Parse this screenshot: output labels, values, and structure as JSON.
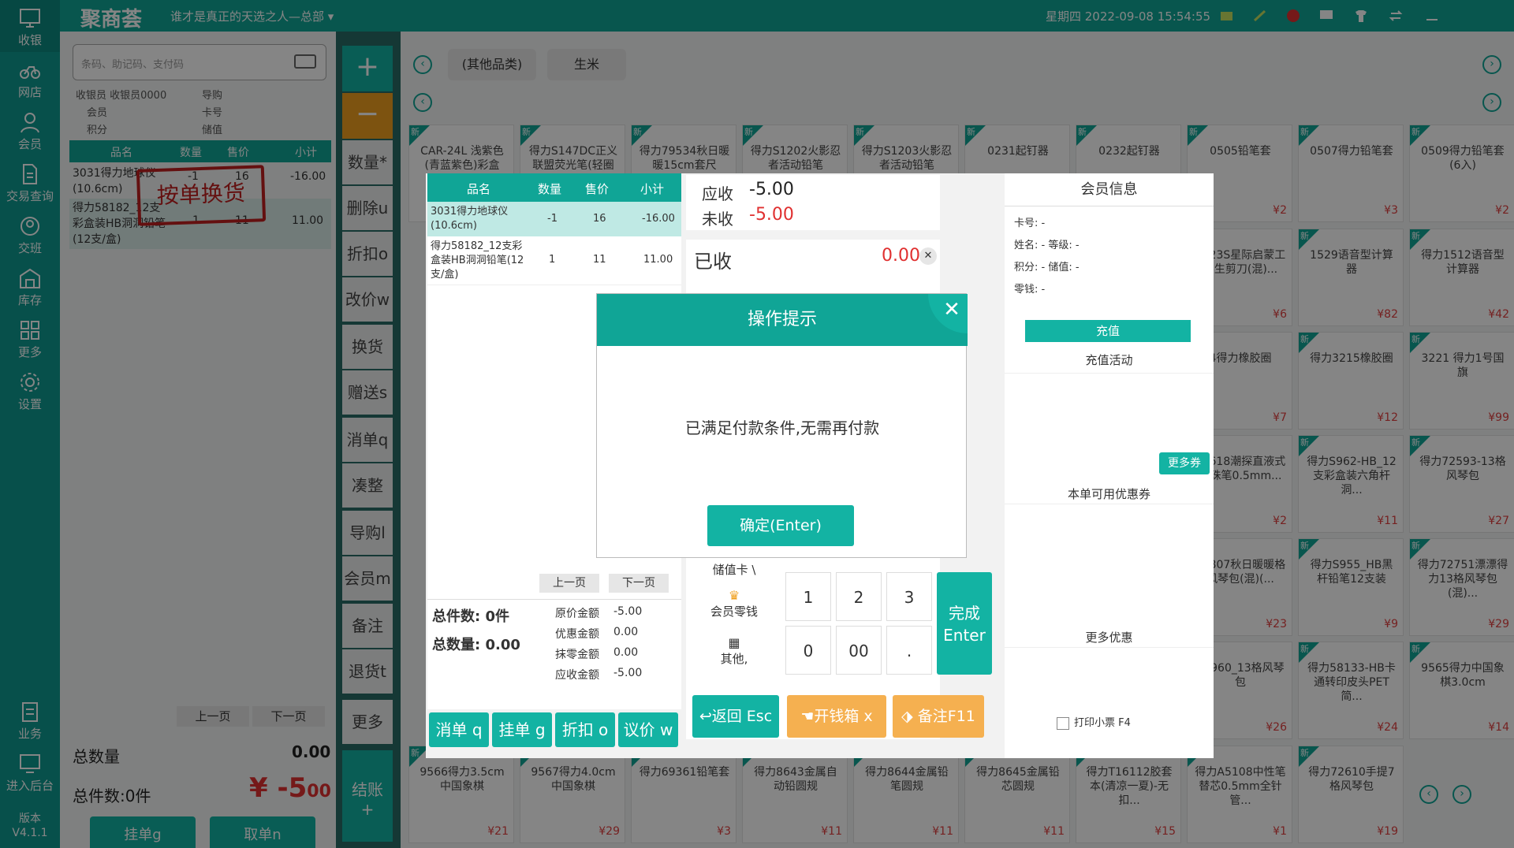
{
  "nav": {
    "items": [
      "收银",
      "网店",
      "会员",
      "交易查询",
      "交班",
      "库存",
      "更多",
      "设置"
    ],
    "bottom": [
      "业务",
      "进入后台"
    ],
    "version_label": "版本",
    "version": "V4.1.1"
  },
  "top": {
    "brand": "聚商荟",
    "slogan": "谁才是真正的天选之人—总部",
    "datetime": "星期四 2022-09-08 15:54:55"
  },
  "left": {
    "search_placeholder": "条码、助记码、支付码",
    "cashier": "收银员 收银员0000",
    "guide": "导购",
    "member": "会员",
    "card": "卡号",
    "points": "积分",
    "balance": "储值",
    "headers": [
      "品名",
      "数量",
      "售价",
      "小计"
    ],
    "rows": [
      {
        "name": "3031得力地球仪(10.6cm)",
        "qty": "-1",
        "price": "16",
        "sub": "-16.00"
      },
      {
        "name": "得力58182_12支彩盒装HB洞洞铅笔(12支/盒)",
        "qty": "1",
        "price": "11",
        "sub": "11.00"
      }
    ],
    "stamp": "按单换货",
    "prev": "上一页",
    "next": "下一页",
    "total_qty_label": "总数量",
    "total_qty": "0.00",
    "total_items_label": "总件数:0件",
    "total_amount": "¥ -5",
    "total_amount_dec": "00",
    "hold": "挂单g",
    "retrieve": "取单n"
  },
  "actions": [
    "数量*",
    "删除u",
    "折扣o",
    "改价w",
    "换货",
    "赠送s",
    "消单q",
    "凑整",
    "导购l",
    "会员m",
    "备注",
    "退货t",
    "更多"
  ],
  "checkout": {
    "label": "结账",
    "plus": "+"
  },
  "plus": "+",
  "minus": "−",
  "tabs": [
    "(其他品类)",
    "生米"
  ],
  "products": [
    {
      "n": "CAR-24L 浅紫色(青蓝紫色)彩盒",
      "p": ""
    },
    {
      "n": "得力S147DC正义联盟荧光笔(轻圈",
      "p": ""
    },
    {
      "n": "得力79534秋日暖暖15cm套尺(混)...",
      "p": ""
    },
    {
      "n": "得力S1202火影忍者活动铅笔",
      "p": ""
    },
    {
      "n": "得力S1203火影忍者活动铅笔",
      "p": ""
    },
    {
      "n": "0231起钉器",
      "p": ""
    },
    {
      "n": "0232起钉器",
      "p": ""
    },
    {
      "n": "0505铅笔套",
      "p": "¥2"
    },
    {
      "n": "0507得力铅笔套",
      "p": "¥3"
    },
    {
      "n": "0509得力铅笔套(6入)",
      "p": "¥2"
    },
    {
      "n": "5023S星际启蒙工学生剪刀(混)...",
      "p": "¥6"
    },
    {
      "n": "1529语音型计算器",
      "p": "¥82"
    },
    {
      "n": "得力1512语音型计算器",
      "p": "¥42"
    },
    {
      "n": "4得力橡胶圈",
      "p": "¥7"
    },
    {
      "n": "得力3215橡胶圈",
      "p": "¥12"
    },
    {
      "n": "3221 得力1号国旗",
      "p": "¥99"
    },
    {
      "n": "S1618潮探直液式走珠笔0.5mm...",
      "p": "¥2"
    },
    {
      "n": "得力S962-HB_12支彩盒装六角杆洞...",
      "p": "¥11"
    },
    {
      "n": "得力72593-13格风琴包",
      "p": "¥27"
    },
    {
      "n": "72807秋日暖暖格风琴包(混)(...",
      "p": "¥23"
    },
    {
      "n": "得力S955_HB黑杆铅笔12支装",
      "p": "¥9"
    },
    {
      "n": "得力72751漂漂得力13格风琴包(混)...",
      "p": "¥29"
    },
    {
      "n": "63960_13格风琴包",
      "p": "¥26"
    },
    {
      "n": "得力58133-HB卡通转印皮头PET简...",
      "p": "¥24"
    },
    {
      "n": "9565得力中国象棋3.0cm",
      "p": "¥14"
    },
    {
      "n": "9566得力3.5cm中国象棋",
      "p": "¥21"
    },
    {
      "n": "9567得力4.0cm中国象棋",
      "p": "¥29"
    },
    {
      "n": "得力69361铅笔套",
      "p": "¥3"
    },
    {
      "n": "得力8643金属自动铅圆规",
      "p": "¥11"
    },
    {
      "n": "得力8644金属铅笔圆规",
      "p": "¥11"
    },
    {
      "n": "得力8645金属铅芯圆规",
      "p": "¥11"
    },
    {
      "n": "得力T16112胶套本(清凉一夏)-无扣...",
      "p": "¥15"
    },
    {
      "n": "得力A5108中性笔替芯0.5mm全针管...",
      "p": "¥1"
    },
    {
      "n": "得力72610手提7格风琴包",
      "p": "¥19"
    }
  ],
  "pay": {
    "headers": [
      "品名",
      "数量",
      "售价",
      "小计"
    ],
    "rows": [
      {
        "name": "3031得力地球仪(10.6cm)",
        "qty": "-1",
        "price": "16",
        "sub": "-16.00"
      },
      {
        "name": "得力58182_12支彩盒装HB洞洞铅笔(12支/盒)",
        "qty": "1",
        "price": "11",
        "sub": "11.00"
      }
    ],
    "prev": "上一页",
    "next": "下一页",
    "total_items": "总件数: 0件",
    "total_qty": "总数量: 0.00",
    "orig_label": "原价金额",
    "orig": "-5.00",
    "disc_label": "优惠金额",
    "disc": "0.00",
    "round_label": "抹零金额",
    "round": "0.00",
    "due_label": "应收金额",
    "due": "-5.00",
    "btns": [
      "消单 q",
      "挂单 g",
      "折扣 o",
      "议价 w"
    ],
    "ys_label": "应收",
    "ys": "-5.00",
    "ws_label": "未收",
    "ws": "-5.00",
    "paid_label": "已收",
    "paid": "0.00",
    "input_val": "0",
    "keys": [
      "1",
      "2",
      "3",
      "0",
      "00",
      "."
    ],
    "opts": [
      "储值卡 \\",
      "会员零钱",
      "其他,"
    ],
    "done": "完成",
    "done_key": "Enter",
    "back": "返回 Esc",
    "drawer": "开钱箱 x",
    "note": "备注F11",
    "member_title": "会员信息",
    "card": "卡号:",
    "card_v": "-",
    "name": "姓名:",
    "name_v": "-",
    "level": "等级:",
    "level_v": "-",
    "pts": "积分:",
    "pts_v": "-",
    "bal": "储值:",
    "bal_v": "-",
    "change": "零钱:",
    "change_v": "-",
    "recharge": "充值",
    "activity": "充值活动",
    "more_coupon": "更多券",
    "coupons": "本单可用优惠券",
    "more_disc": "更多优惠",
    "print": "打印小票 F4"
  },
  "alert": {
    "title": "操作提示",
    "msg": "已满足付款条件,无需再付款",
    "ok": "确定(Enter)"
  }
}
